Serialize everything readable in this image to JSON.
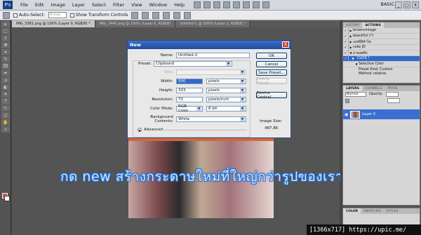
{
  "menubar": {
    "logo": "Ps",
    "items": [
      "File",
      "Edit",
      "Image",
      "Layer",
      "Select",
      "Filter",
      "View",
      "Window",
      "Help"
    ],
    "workspace": "BASIC",
    "ctrls": [
      "_",
      "□",
      "X"
    ]
  },
  "options": {
    "auto_select_label": "Auto-Select:",
    "auto_select_value": "Group",
    "transform_label": "Show Transform Controls"
  },
  "tools": [
    "▸",
    "⬚",
    "ℓ",
    "✥",
    "⌗",
    "✎",
    "⌧",
    "✒",
    "⌂",
    "◐",
    "✦",
    "T",
    "↖",
    "◻",
    "✋",
    "⌕"
  ],
  "doc_tabs": [
    "IMG_3381.png @ 100% (Layer 0, RGB/8) *",
    "IMG_3440.png @ 100% (Layer 0, RGB/8)",
    "Untitled-1 @ 100% (Layer 1, RGB/8) *"
  ],
  "dialog": {
    "title": "New",
    "close": "X",
    "name_label": "Name:",
    "name_value": "Untitled-2",
    "preset_label": "Preset:",
    "preset_value": "Clipboard",
    "size_label": "Size:",
    "width_label": "Width:",
    "width_value": "500",
    "width_unit": "pixels",
    "height_label": "Height:",
    "height_value": "333",
    "height_unit": "pixels",
    "resolution_label": "Resolution:",
    "resolution_value": "72",
    "resolution_unit": "pixels/inch",
    "color_mode_label": "Color Mode:",
    "color_mode_value": "RGB Color",
    "bit_depth": "8 bit",
    "bg_label": "Background Contents:",
    "bg_value": "White",
    "advanced": "Advanced",
    "ok": "OK",
    "cancel": "Cancel",
    "save_preset": "Save Preset...",
    "delete_preset": "Delete Preset...",
    "device_central": "Device Central...",
    "image_size_label": "Image Size:",
    "image_size_value": "487.8K"
  },
  "caption": "กด new สร้างกระดาษใหม่ที่ใหญ่กว่ารูปของเรา",
  "history": {
    "tabs": [
      "HISTORY",
      "ACTIONS"
    ],
    "rows": [
      {
        "text": "brownvintage",
        "kind": "folder"
      },
      {
        "text": "beautiful (?)",
        "kind": "folder"
      },
      {
        "text": "เลขที่มีคำโต",
        "kind": "folder"
      },
      {
        "text": "coke JD",
        "kind": "folder"
      },
      {
        "text": "ภาพสดพึง",
        "kind": "folder"
      },
      {
        "text": "CLICK !",
        "kind": "selected"
      },
      {
        "text": "Selective Color",
        "kind": "sub"
      },
      {
        "text": "Preset Kind: Custom",
        "kind": "sub2"
      },
      {
        "text": "Method: relative",
        "kind": "sub2"
      }
    ]
  },
  "layers": {
    "tabs": [
      "LAYERS",
      "CHANNELS",
      "PATHS"
    ],
    "blend_mode": "Normal",
    "opacity_label": "Opacity:",
    "layer_name": "Layer 0"
  },
  "color_panel": {
    "tabs": [
      "COLOR",
      "SWATCHES",
      "STYLES"
    ]
  },
  "badge": "[1366x717] https://upic.me/"
}
